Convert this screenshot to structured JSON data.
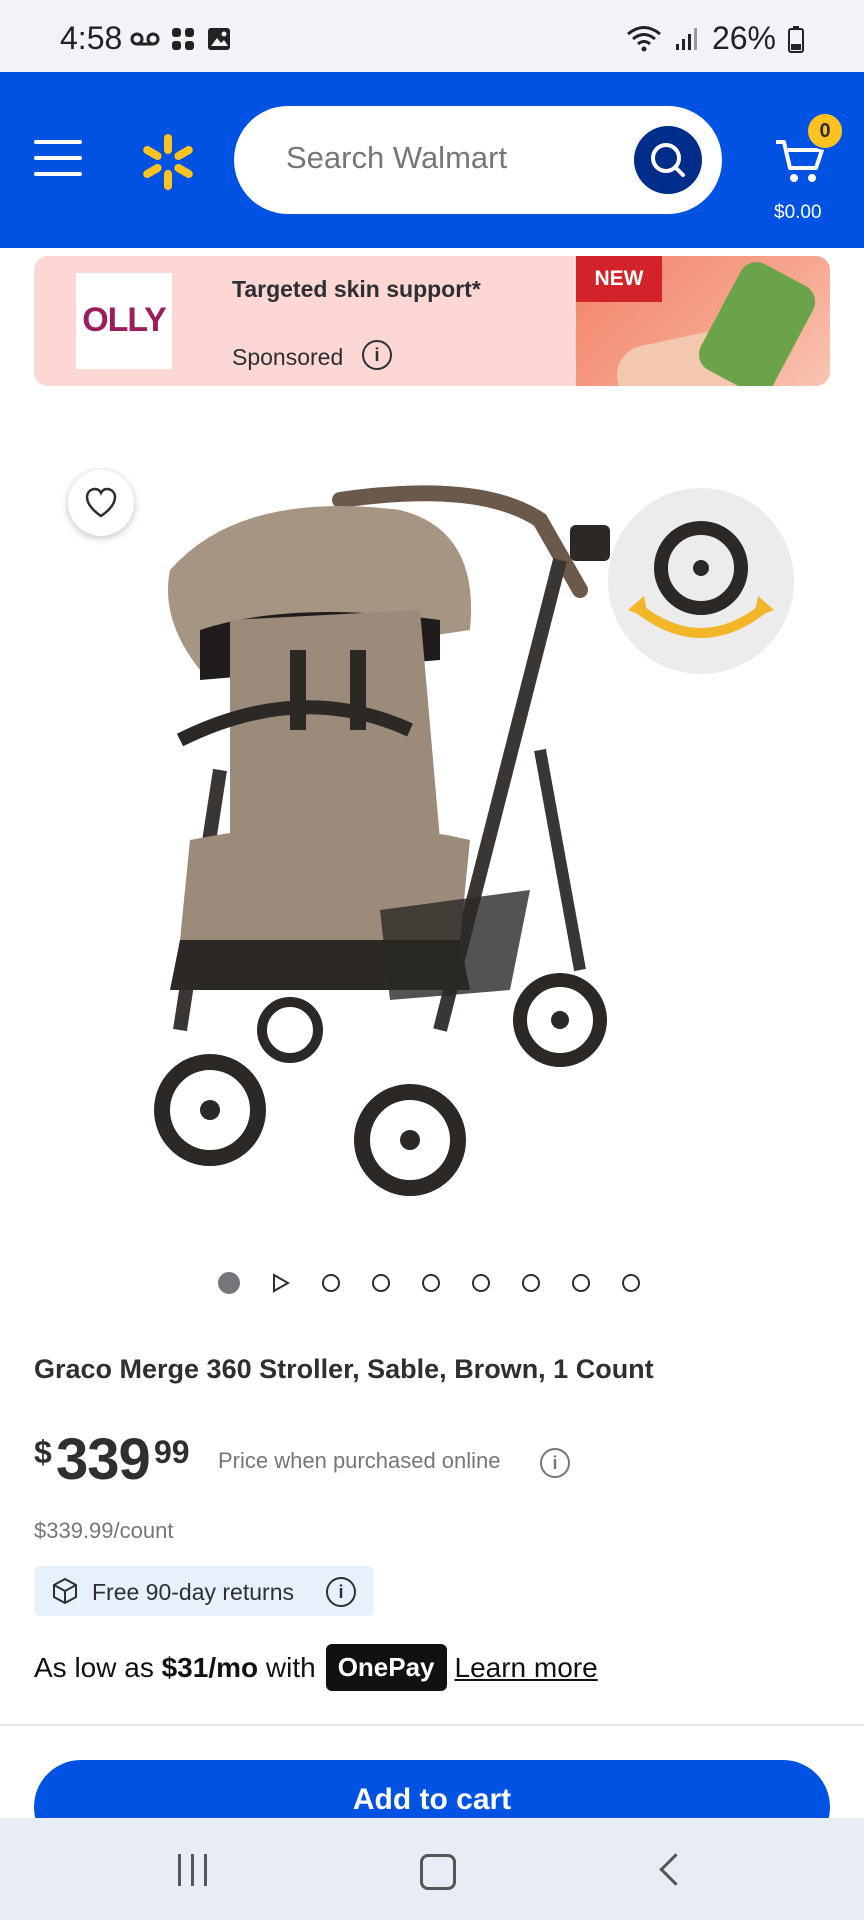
{
  "status_bar": {
    "time": "4:58",
    "battery": "26%"
  },
  "header": {
    "search_placeholder": "Search Walmart",
    "cart_count": "0",
    "cart_total": "$0.00",
    "colors": {
      "header_bg": "#0053e2",
      "spark": "#ffc220"
    }
  },
  "ad": {
    "brand": "OLLY",
    "title": "Targeted skin support*",
    "sponsored": "Sponsored",
    "badge": "NEW"
  },
  "gallery": {
    "slide_count": 9,
    "active_index": 0
  },
  "product": {
    "title": "Graco Merge 360 Stroller, Sable, Brown, 1 Count",
    "currency": "$",
    "price_dollars": "339",
    "price_cents": "99",
    "price_note": "Price when purchased online",
    "unit_price": "$339.99/count",
    "returns": "Free 90-day returns"
  },
  "financing": {
    "prefix": "As low as",
    "amount": "$31/mo",
    "with": "with",
    "provider": "OnePay",
    "link": "Learn more"
  },
  "actions": {
    "add_to_cart": "Add to cart"
  }
}
